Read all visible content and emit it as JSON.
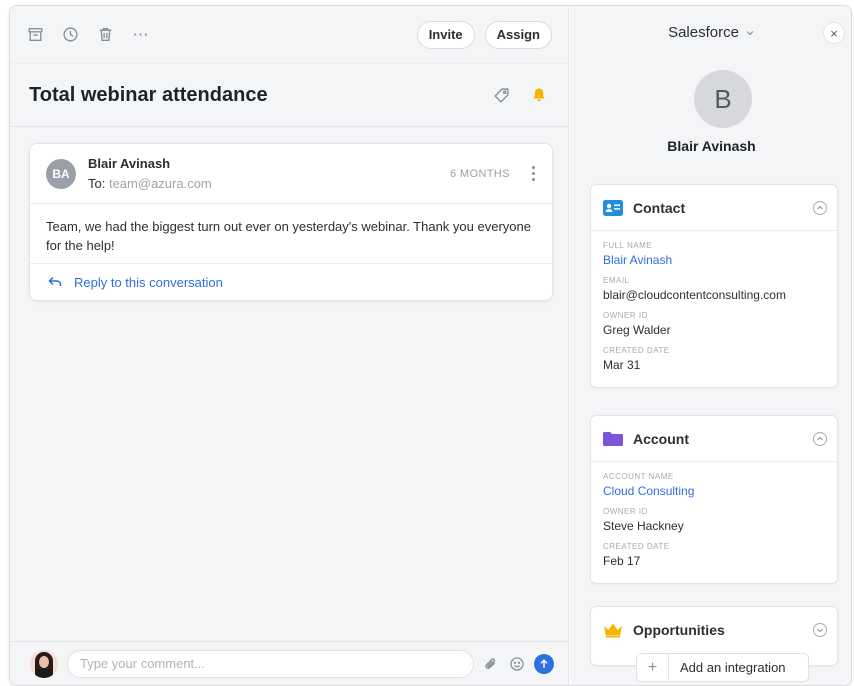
{
  "toolbar": {
    "icons": [
      "archive-icon",
      "clock-icon",
      "trash-icon",
      "more-icon"
    ],
    "invite_label": "Invite",
    "assign_label": "Assign"
  },
  "conversation": {
    "title": "Total webinar attendance",
    "message": {
      "avatar_initials": "BA",
      "sender": "Blair Avinash",
      "to_label": "To:",
      "to_address": "team@azura.com",
      "time": "6 MONTHS",
      "body": "Team, we had the biggest turn out ever on yesterday's webinar. Thank you everyone for the help!",
      "reply_label": "Reply to this conversation"
    }
  },
  "composer": {
    "placeholder": "Type your comment..."
  },
  "sidebar": {
    "integration": "Salesforce",
    "profile": {
      "initial": "B",
      "name": "Blair Avinash"
    },
    "contact": {
      "title": "Contact",
      "fields": [
        {
          "label": "FULL NAME",
          "value": "Blair Avinash"
        },
        {
          "label": "EMAIL",
          "value": "blair@cloudcontentconsulting.com"
        },
        {
          "label": "OWNER ID",
          "value": "Greg Walder"
        },
        {
          "label": "CREATED DATE",
          "value": "Mar 31"
        }
      ]
    },
    "account": {
      "title": "Account",
      "fields": [
        {
          "label": "ACCOUNT NAME",
          "value": "Cloud Consulting"
        },
        {
          "label": "OWNER ID",
          "value": "Steve Hackney"
        },
        {
          "label": "CREATED DATE",
          "value": "Feb 17"
        }
      ]
    },
    "opportunities": {
      "title": "Opportunities"
    },
    "add_integration_label": "Add an integration"
  },
  "colors": {
    "accent": "#2f6fe0",
    "bell": "#f5b400",
    "contact_icon": "#1f8fe0",
    "account_icon": "#7b55d9",
    "opportunities_icon": "#f5b400"
  }
}
